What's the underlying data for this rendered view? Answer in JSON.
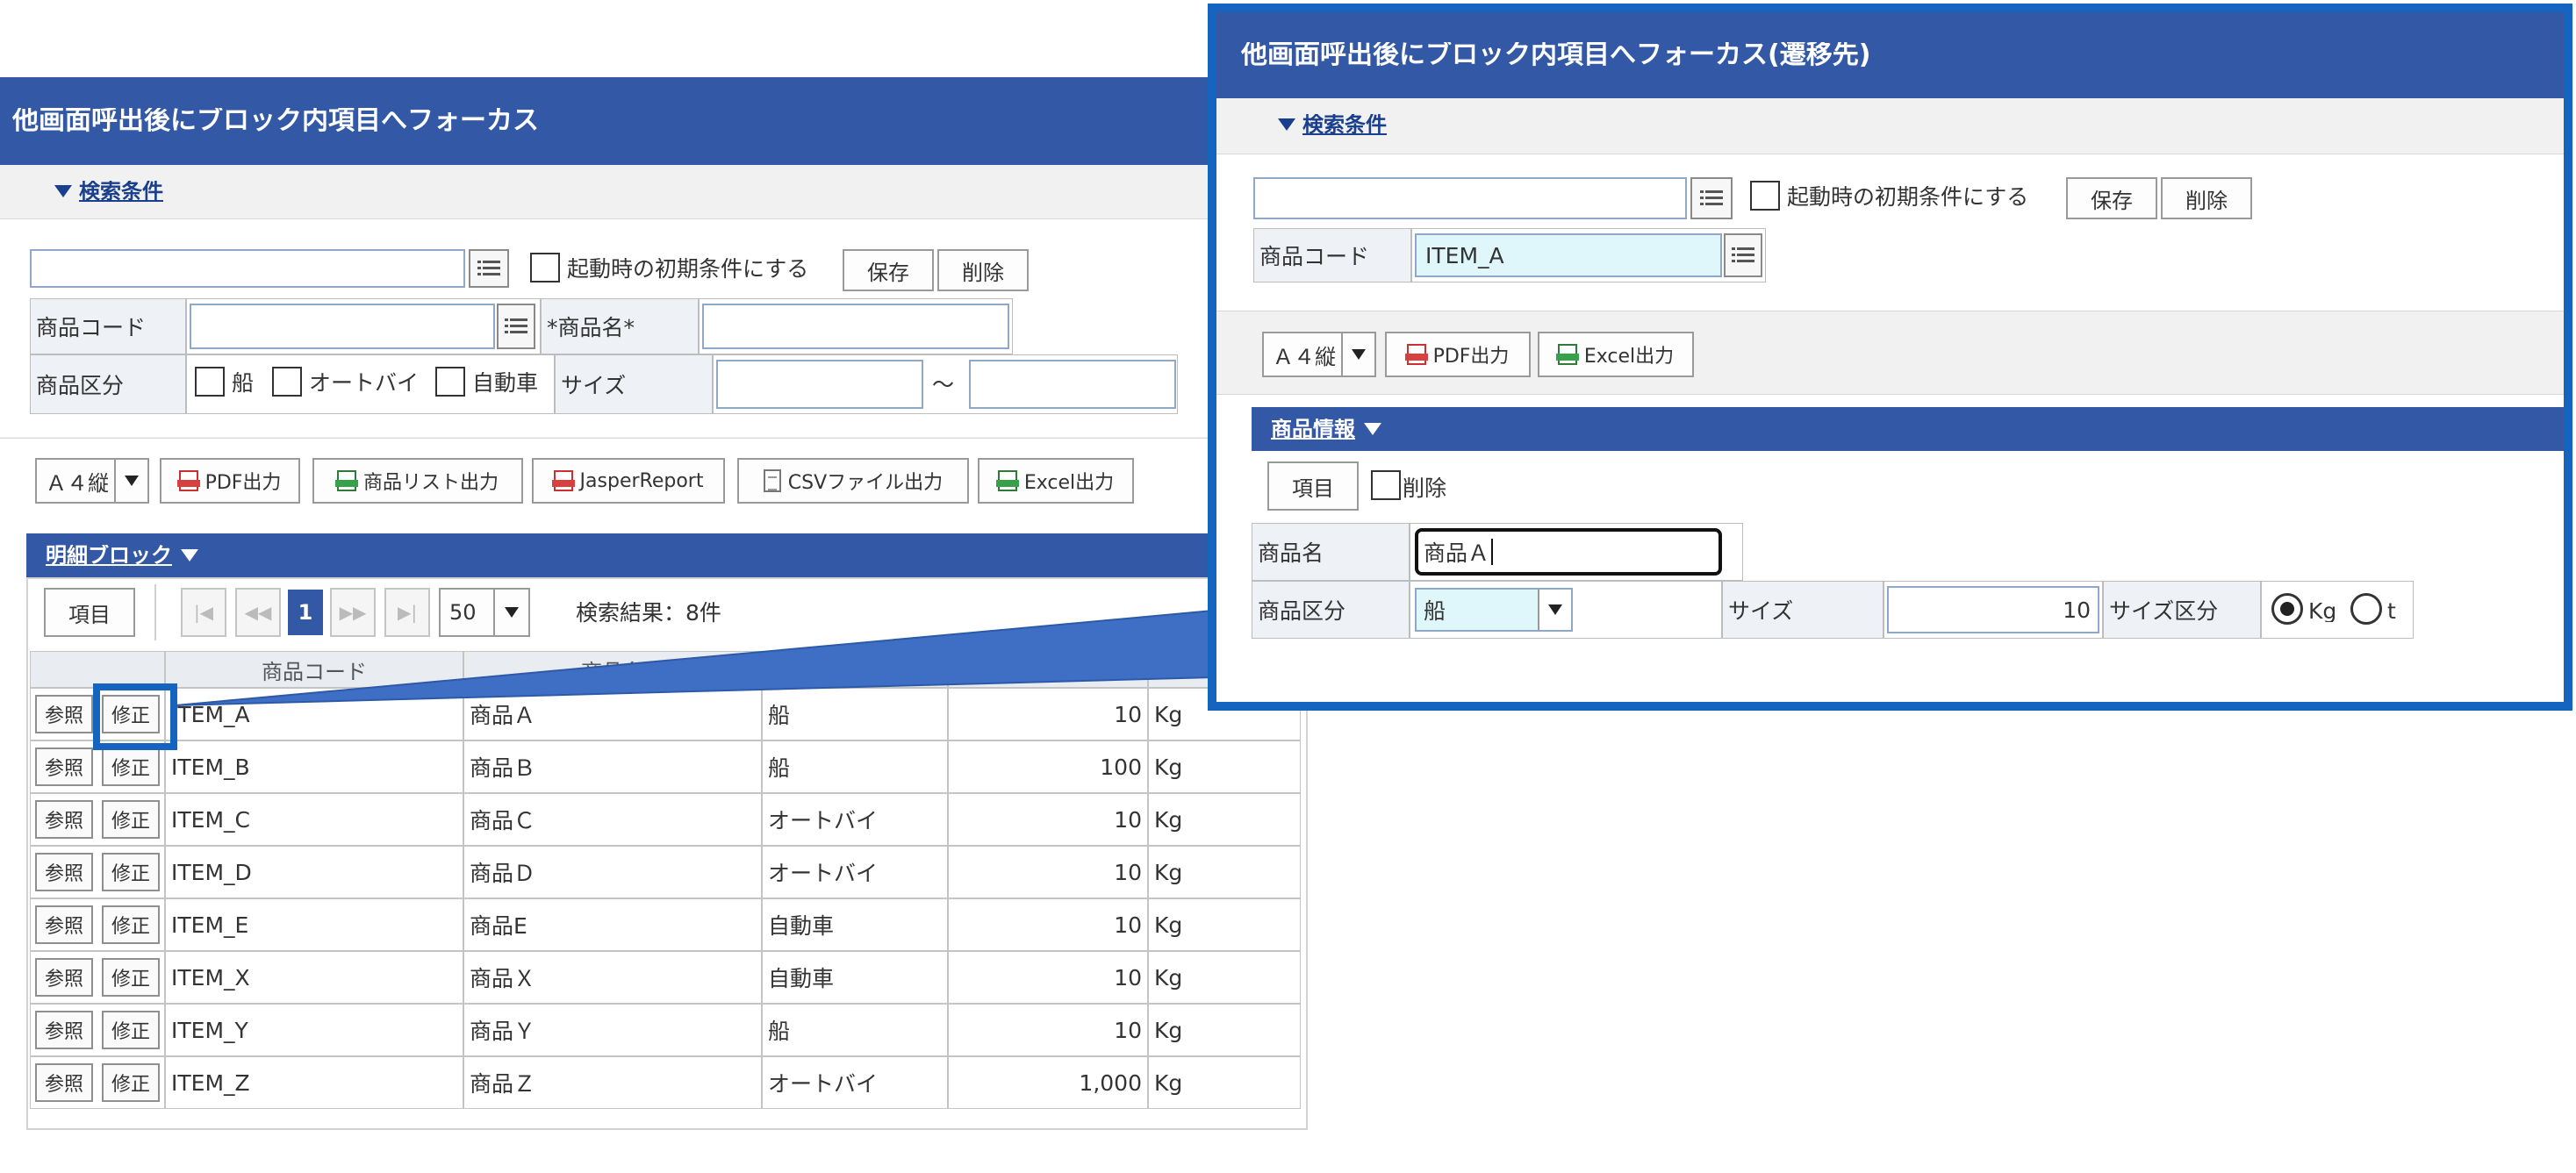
{
  "left": {
    "title": "他画面呼出後にブロック内項目へフォーカス",
    "search_toggle": "検索条件",
    "startup_label": "起動時の初期条件にする",
    "save_label": "保存",
    "delete_label": "削除",
    "fields": {
      "product_code_label": "商品コード",
      "product_name_label": "*商品名*",
      "category_label": "商品区分",
      "category_options": [
        "船",
        "オートバイ",
        "自動車"
      ],
      "size_label": "サイズ",
      "range_sep": "～"
    },
    "toolbar": {
      "paper": "Ａ４縦",
      "pdf": "PDF出力",
      "list": "商品リスト出力",
      "jasper": "JasperReport",
      "csv": "CSVファイル出力",
      "excel": "Excel出力"
    },
    "detail_block": {
      "title": "明細ブロック",
      "items_btn": "項目",
      "page": "1",
      "per_page": "50",
      "result": "検索結果：8件",
      "col_code": "商品コード",
      "col_name_partial": "商品名",
      "ref_label": "参照",
      "edit_label": "修正",
      "rows": [
        {
          "code": "ITEM_A",
          "name": "商品Ａ",
          "category": "船",
          "size": "10",
          "unit": "Kg"
        },
        {
          "code": "ITEM_B",
          "name": "商品Ｂ",
          "category": "船",
          "size": "100",
          "unit": "Kg"
        },
        {
          "code": "ITEM_C",
          "name": "商品Ｃ",
          "category": "オートバイ",
          "size": "10",
          "unit": "Kg"
        },
        {
          "code": "ITEM_D",
          "name": "商品Ｄ",
          "category": "オートバイ",
          "size": "10",
          "unit": "Kg"
        },
        {
          "code": "ITEM_E",
          "name": "商品E",
          "category": "自動車",
          "size": "10",
          "unit": "Kg"
        },
        {
          "code": "ITEM_X",
          "name": "商品Ｘ",
          "category": "自動車",
          "size": "10",
          "unit": "Kg"
        },
        {
          "code": "ITEM_Y",
          "name": "商品Ｙ",
          "category": "船",
          "size": "10",
          "unit": "Kg"
        },
        {
          "code": "ITEM_Z",
          "name": "商品Ｚ",
          "category": "オートバイ",
          "size": "1,000",
          "unit": "Kg"
        }
      ]
    }
  },
  "right": {
    "title": "他画面呼出後にブロック内項目へフォーカス(遷移先)",
    "search_toggle": "検索条件",
    "startup_label": "起動時の初期条件にする",
    "save_label": "保存",
    "delete_label": "削除",
    "product_code_label": "商品コード",
    "product_code_value": "ITEM_A",
    "toolbar": {
      "paper": "Ａ４縦",
      "pdf": "PDF出力",
      "excel": "Excel出力"
    },
    "info_block": {
      "title": "商品情報",
      "items_btn": "項目",
      "delete_label": "削除",
      "name_label": "商品名",
      "name_value": "商品Ａ",
      "category_label": "商品区分",
      "category_value": "船",
      "size_label": "サイズ",
      "size_value": "10",
      "size_unit_label": "サイズ区分",
      "unit_options": [
        "Kg",
        "t"
      ],
      "unit_selected": "Kg"
    }
  },
  "colors": {
    "header_blue": "#3358a5",
    "highlight_blue": "#1565c0",
    "field_cyan": "#dff7fb"
  },
  "icons": [
    "list-icon",
    "dropdown-arrow-icon",
    "pdf-icon",
    "excel-icon",
    "csv-icon",
    "first-page-icon",
    "prev-page-icon",
    "next-page-icon",
    "last-page-icon",
    "triangle-down-icon"
  ]
}
